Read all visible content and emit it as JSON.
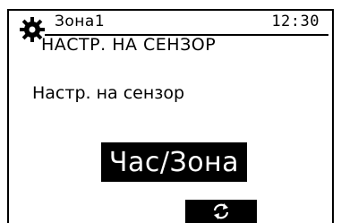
{
  "header": {
    "zone": "Зона1",
    "time": "12:30",
    "menu_title": "НАСТР. НА СЕНЗОР",
    "settings_icon": "gear-icon"
  },
  "content": {
    "subtitle": "Настр. на сензор",
    "selected_value": "Час/Зона"
  },
  "function_keys": [
    {
      "icon": "refresh-icon"
    }
  ]
}
